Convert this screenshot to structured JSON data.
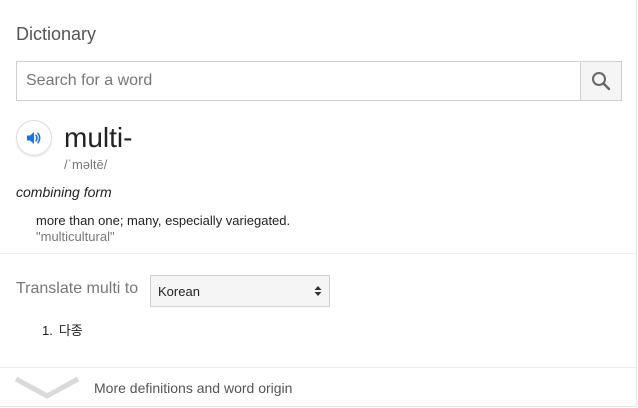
{
  "dictionary": {
    "title": "Dictionary",
    "search": {
      "placeholder": "Search for a word",
      "value": ""
    },
    "entry": {
      "headword": "multi-",
      "phonetic": "/ˈməltē/",
      "part_of_speech": "combining form",
      "definition": "more than one; many, especially variegated.",
      "example": "\"multicultural\""
    },
    "translate": {
      "label": "Translate multi to",
      "selected_language": "Korean",
      "results": [
        {
          "number": "1.",
          "text": "다종"
        }
      ]
    },
    "more_link": "More definitions and word origin"
  },
  "colors": {
    "accent_blue": "#1a73e8",
    "muted_text": "#777777",
    "border": "#cfcfcf"
  },
  "icons": {
    "search": "search-icon",
    "speaker": "speaker-icon",
    "select_arrows": "updown-arrows-icon",
    "expand": "chevron-down-icon"
  }
}
